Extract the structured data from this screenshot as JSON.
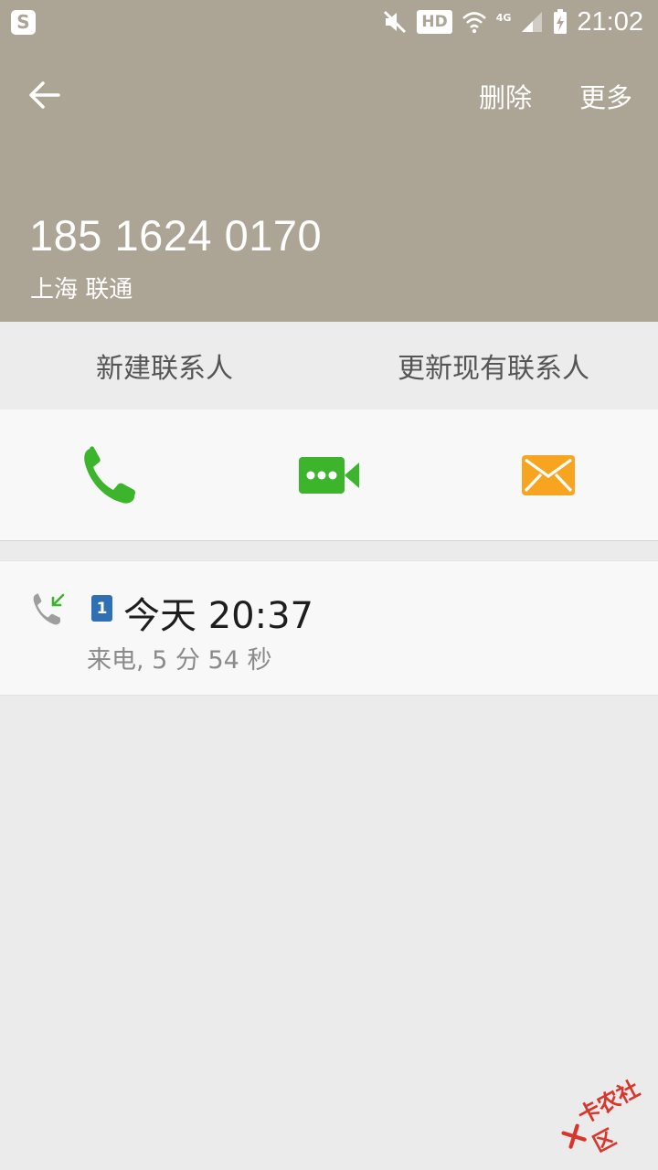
{
  "statusbar": {
    "app_icon_label": "S",
    "hd_label": "HD",
    "network_label": "4G",
    "time": "21:02"
  },
  "toolbar": {
    "back_icon": "back-arrow-icon",
    "delete_label": "删除",
    "more_label": "更多"
  },
  "contact": {
    "number": "185 1624 0170",
    "carrier": "上海 联通"
  },
  "contact_actions": {
    "new_contact_label": "新建联系人",
    "update_contact_label": "更新现有联系人"
  },
  "quick_actions": [
    {
      "icon": "phone-icon",
      "color": "#3cb52c"
    },
    {
      "icon": "video-call-icon",
      "color": "#3cb52c"
    },
    {
      "icon": "message-icon",
      "color": "#f7a521"
    }
  ],
  "call_log": [
    {
      "icon": "incoming-call-icon",
      "sim": "1",
      "time": "今天 20:37",
      "detail": "来电, 5 分 54 秒"
    }
  ],
  "watermark": {
    "text": "卡农社区"
  },
  "colors": {
    "header_bg": "#aca596",
    "green": "#3cb52c",
    "orange": "#f7a521",
    "sim_blue": "#2f6fb3"
  }
}
